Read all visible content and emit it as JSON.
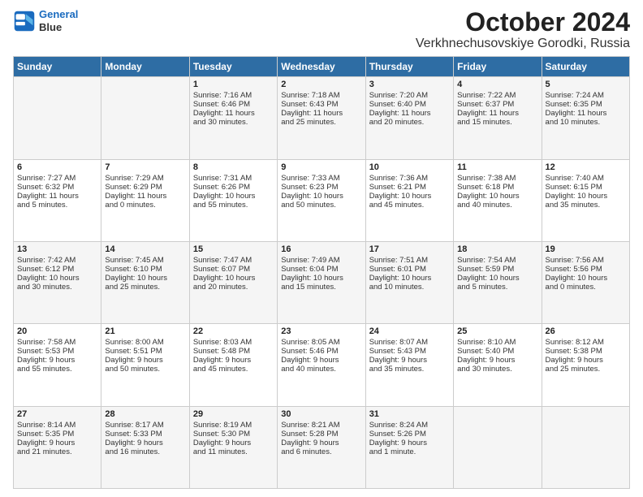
{
  "header": {
    "logo_line1": "General",
    "logo_line2": "Blue",
    "title": "October 2024",
    "subtitle": "Verkhnechusovskiye Gorodki, Russia"
  },
  "weekdays": [
    "Sunday",
    "Monday",
    "Tuesday",
    "Wednesday",
    "Thursday",
    "Friday",
    "Saturday"
  ],
  "weeks": [
    [
      {
        "day": "",
        "info": ""
      },
      {
        "day": "",
        "info": ""
      },
      {
        "day": "1",
        "info": "Sunrise: 7:16 AM\nSunset: 6:46 PM\nDaylight: 11 hours\nand 30 minutes."
      },
      {
        "day": "2",
        "info": "Sunrise: 7:18 AM\nSunset: 6:43 PM\nDaylight: 11 hours\nand 25 minutes."
      },
      {
        "day": "3",
        "info": "Sunrise: 7:20 AM\nSunset: 6:40 PM\nDaylight: 11 hours\nand 20 minutes."
      },
      {
        "day": "4",
        "info": "Sunrise: 7:22 AM\nSunset: 6:37 PM\nDaylight: 11 hours\nand 15 minutes."
      },
      {
        "day": "5",
        "info": "Sunrise: 7:24 AM\nSunset: 6:35 PM\nDaylight: 11 hours\nand 10 minutes."
      }
    ],
    [
      {
        "day": "6",
        "info": "Sunrise: 7:27 AM\nSunset: 6:32 PM\nDaylight: 11 hours\nand 5 minutes."
      },
      {
        "day": "7",
        "info": "Sunrise: 7:29 AM\nSunset: 6:29 PM\nDaylight: 11 hours\nand 0 minutes."
      },
      {
        "day": "8",
        "info": "Sunrise: 7:31 AM\nSunset: 6:26 PM\nDaylight: 10 hours\nand 55 minutes."
      },
      {
        "day": "9",
        "info": "Sunrise: 7:33 AM\nSunset: 6:23 PM\nDaylight: 10 hours\nand 50 minutes."
      },
      {
        "day": "10",
        "info": "Sunrise: 7:36 AM\nSunset: 6:21 PM\nDaylight: 10 hours\nand 45 minutes."
      },
      {
        "day": "11",
        "info": "Sunrise: 7:38 AM\nSunset: 6:18 PM\nDaylight: 10 hours\nand 40 minutes."
      },
      {
        "day": "12",
        "info": "Sunrise: 7:40 AM\nSunset: 6:15 PM\nDaylight: 10 hours\nand 35 minutes."
      }
    ],
    [
      {
        "day": "13",
        "info": "Sunrise: 7:42 AM\nSunset: 6:12 PM\nDaylight: 10 hours\nand 30 minutes."
      },
      {
        "day": "14",
        "info": "Sunrise: 7:45 AM\nSunset: 6:10 PM\nDaylight: 10 hours\nand 25 minutes."
      },
      {
        "day": "15",
        "info": "Sunrise: 7:47 AM\nSunset: 6:07 PM\nDaylight: 10 hours\nand 20 minutes."
      },
      {
        "day": "16",
        "info": "Sunrise: 7:49 AM\nSunset: 6:04 PM\nDaylight: 10 hours\nand 15 minutes."
      },
      {
        "day": "17",
        "info": "Sunrise: 7:51 AM\nSunset: 6:01 PM\nDaylight: 10 hours\nand 10 minutes."
      },
      {
        "day": "18",
        "info": "Sunrise: 7:54 AM\nSunset: 5:59 PM\nDaylight: 10 hours\nand 5 minutes."
      },
      {
        "day": "19",
        "info": "Sunrise: 7:56 AM\nSunset: 5:56 PM\nDaylight: 10 hours\nand 0 minutes."
      }
    ],
    [
      {
        "day": "20",
        "info": "Sunrise: 7:58 AM\nSunset: 5:53 PM\nDaylight: 9 hours\nand 55 minutes."
      },
      {
        "day": "21",
        "info": "Sunrise: 8:00 AM\nSunset: 5:51 PM\nDaylight: 9 hours\nand 50 minutes."
      },
      {
        "day": "22",
        "info": "Sunrise: 8:03 AM\nSunset: 5:48 PM\nDaylight: 9 hours\nand 45 minutes."
      },
      {
        "day": "23",
        "info": "Sunrise: 8:05 AM\nSunset: 5:46 PM\nDaylight: 9 hours\nand 40 minutes."
      },
      {
        "day": "24",
        "info": "Sunrise: 8:07 AM\nSunset: 5:43 PM\nDaylight: 9 hours\nand 35 minutes."
      },
      {
        "day": "25",
        "info": "Sunrise: 8:10 AM\nSunset: 5:40 PM\nDaylight: 9 hours\nand 30 minutes."
      },
      {
        "day": "26",
        "info": "Sunrise: 8:12 AM\nSunset: 5:38 PM\nDaylight: 9 hours\nand 25 minutes."
      }
    ],
    [
      {
        "day": "27",
        "info": "Sunrise: 8:14 AM\nSunset: 5:35 PM\nDaylight: 9 hours\nand 21 minutes."
      },
      {
        "day": "28",
        "info": "Sunrise: 8:17 AM\nSunset: 5:33 PM\nDaylight: 9 hours\nand 16 minutes."
      },
      {
        "day": "29",
        "info": "Sunrise: 8:19 AM\nSunset: 5:30 PM\nDaylight: 9 hours\nand 11 minutes."
      },
      {
        "day": "30",
        "info": "Sunrise: 8:21 AM\nSunset: 5:28 PM\nDaylight: 9 hours\nand 6 minutes."
      },
      {
        "day": "31",
        "info": "Sunrise: 8:24 AM\nSunset: 5:26 PM\nDaylight: 9 hours\nand 1 minute."
      },
      {
        "day": "",
        "info": ""
      },
      {
        "day": "",
        "info": ""
      }
    ]
  ]
}
